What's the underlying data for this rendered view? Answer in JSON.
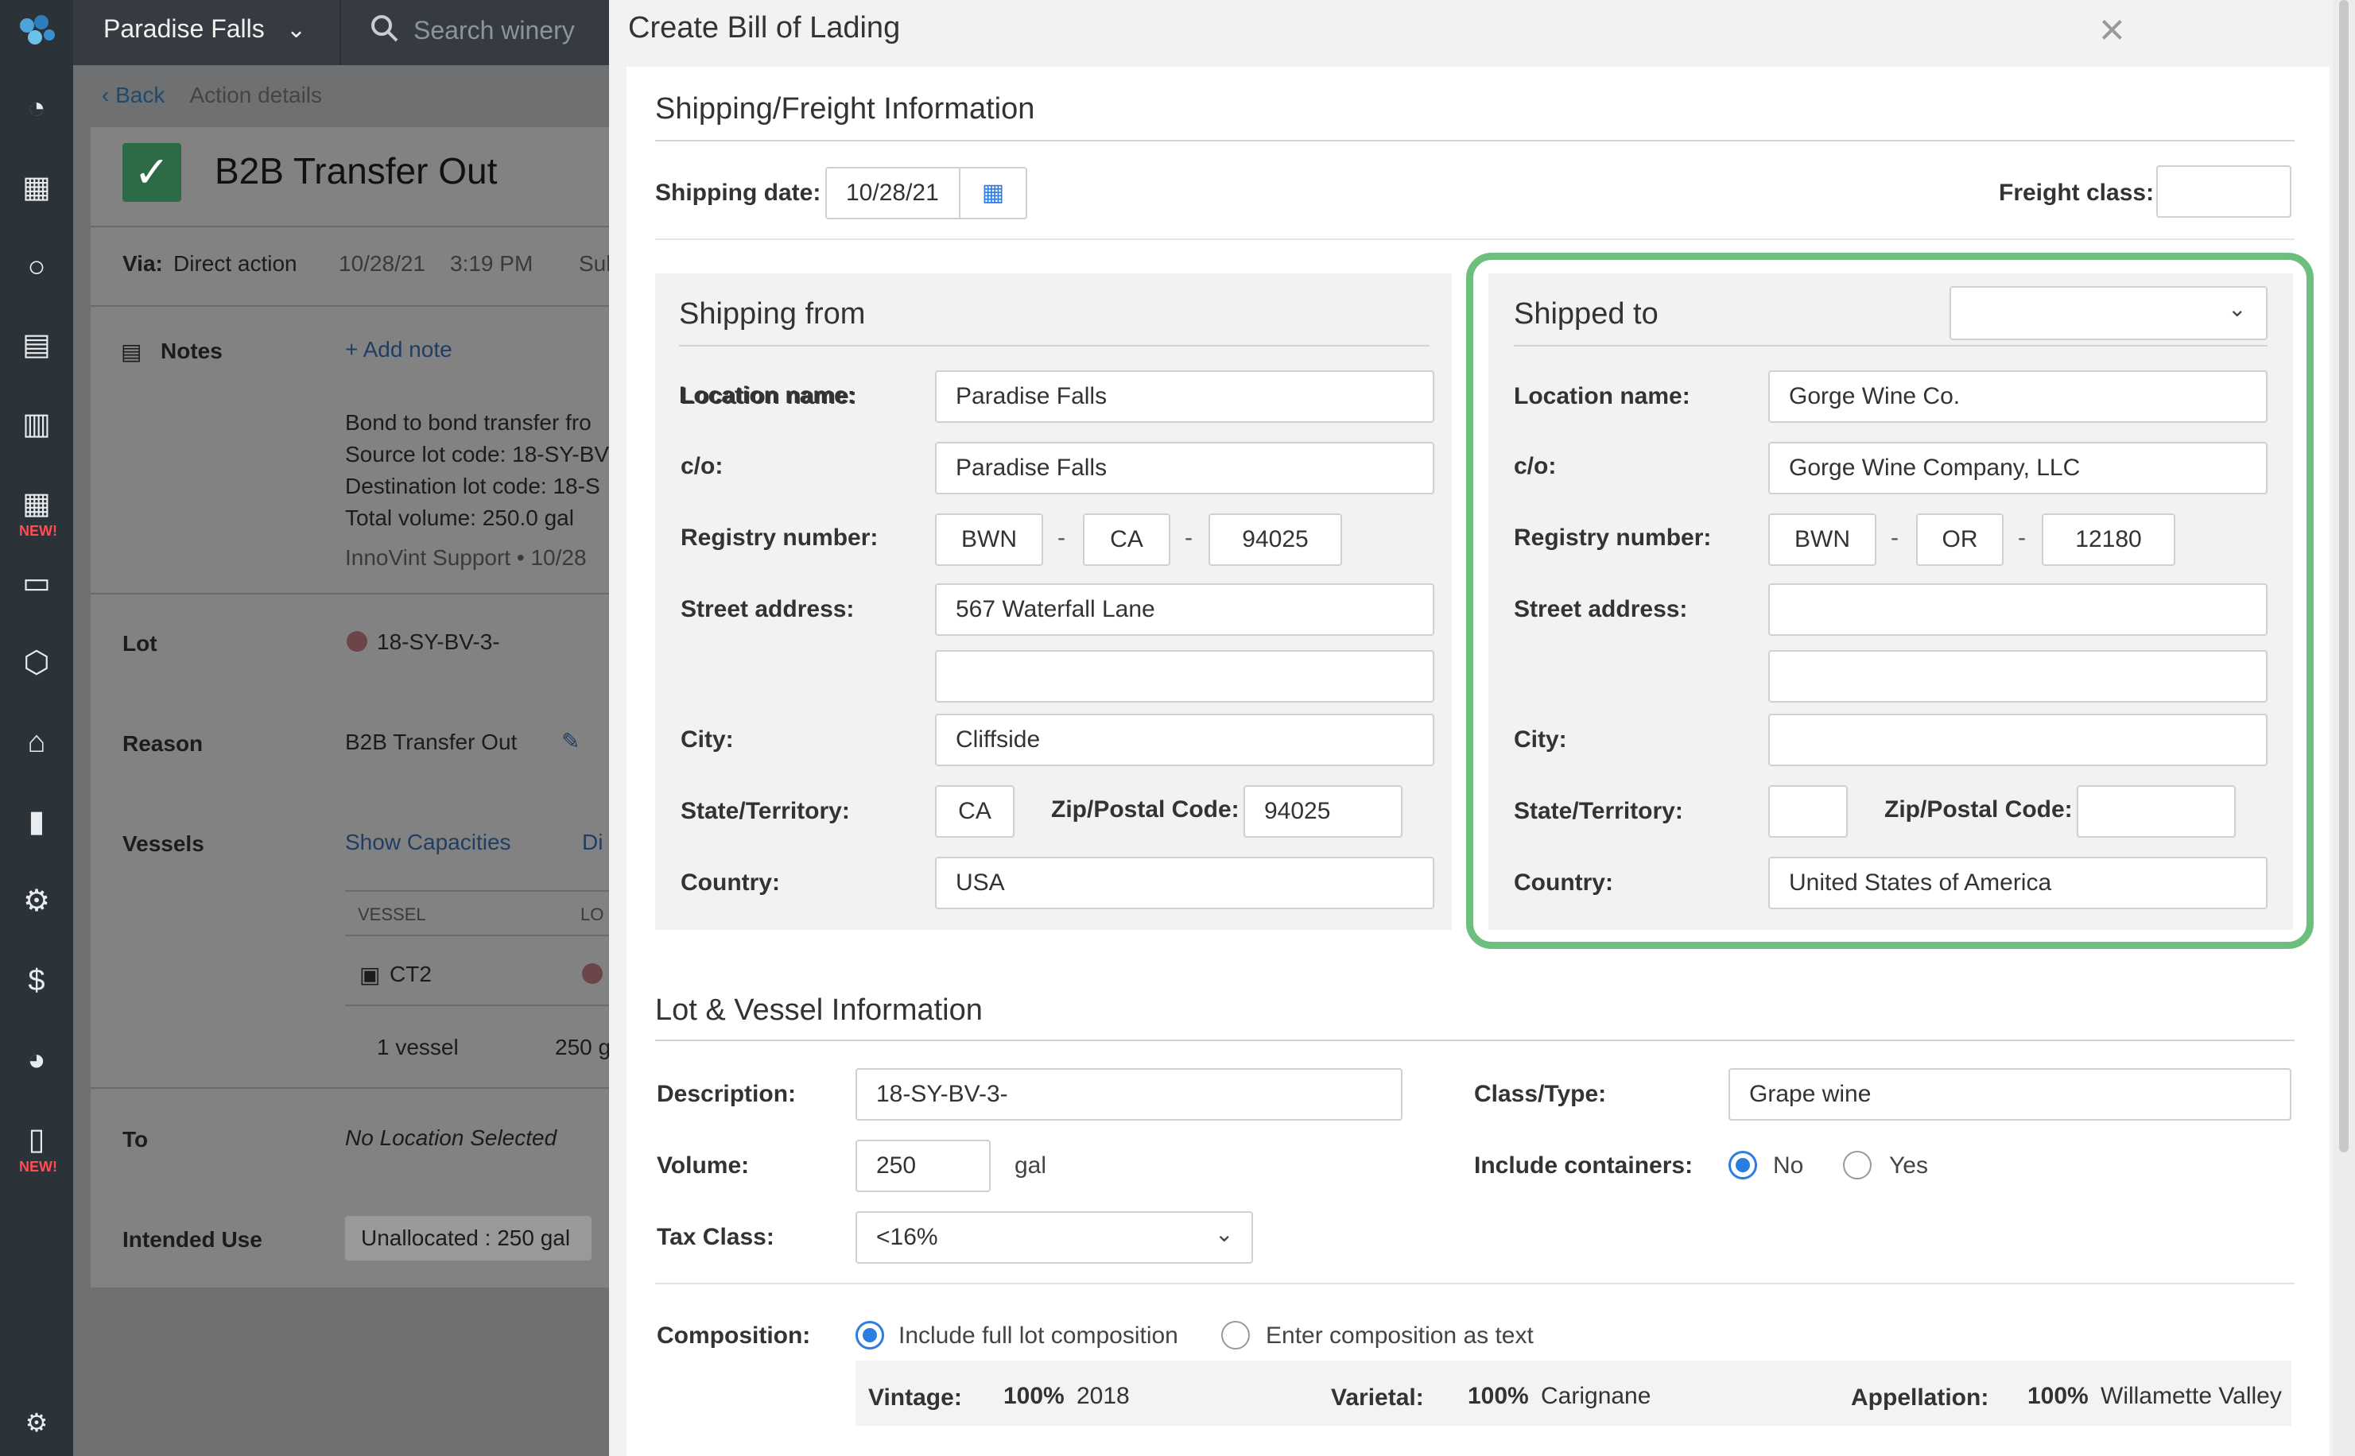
{
  "nav": {
    "winery": "Paradise Falls",
    "search_placeholder": "Search winery",
    "new_badge": "NEW!"
  },
  "background": {
    "back": "Back",
    "breadcrumb": "Action details",
    "title": "B2B Transfer Out",
    "via_label": "Via:",
    "via_value": "Direct action",
    "date": "10/28/21",
    "time": "3:19 PM",
    "truncated_sub": "Sul",
    "notes_label": "Notes",
    "add_note": "+ Add note",
    "note_lines": [
      "Bond to bond transfer fro",
      "Source lot code: 18-SY-BV",
      "Destination lot code: 18-S",
      "Total volume: 250.0 gal"
    ],
    "note_author": "InnoVint Support  •  10/28",
    "lot_label": "Lot",
    "lot_value": "18-SY-BV-3-",
    "reason_label": "Reason",
    "reason_value": "B2B Transfer Out",
    "vessels_label": "Vessels",
    "show_capacities": "Show Capacities",
    "dis_truncated": "Di",
    "vessel_col": "VESSEL",
    "lot_col": "LO",
    "vessel_name": "CT2",
    "vessel_count": "1 vessel",
    "vessel_gal": "250 g",
    "to_label": "To",
    "to_value": "No Location Selected",
    "intended_label": "Intended Use",
    "intended_value": "Unallocated : 250 gal"
  },
  "modal": {
    "title": "Create Bill of Lading",
    "shipping_section": "Shipping/Freight Information",
    "shipping_date_label": "Shipping date:",
    "shipping_date": "10/28/21",
    "freight_label": "Freight class:",
    "freight_value": "",
    "from": {
      "title": "Shipping from",
      "location_label": "Location name:",
      "location": "Paradise Falls",
      "co_label": "c/o:",
      "co": "Paradise Falls",
      "registry_label": "Registry number:",
      "reg1": "BWN",
      "reg2": "CA",
      "reg3": "94025",
      "street_label": "Street address:",
      "street1": "567 Waterfall Lane",
      "street2": "",
      "city_label": "City:",
      "city": "Cliffside",
      "state_label": "State/Territory:",
      "state": "CA",
      "zip_label": "Zip/Postal Code:",
      "zip": "94025",
      "country_label": "Country:",
      "country": "USA"
    },
    "to": {
      "title": "Shipped to",
      "select_value": "",
      "location_label": "Location name:",
      "location": "Gorge Wine Co.",
      "co_label": "c/o:",
      "co": "Gorge Wine Company, LLC",
      "registry_label": "Registry number:",
      "reg1": "BWN",
      "reg2": "OR",
      "reg3": "12180",
      "street_label": "Street address:",
      "street1": "",
      "street2": "",
      "city_label": "City:",
      "city": "",
      "state_label": "State/Territory:",
      "state": "",
      "zip_label": "Zip/Postal Code:",
      "zip": "",
      "country_label": "Country:",
      "country": "United States of America"
    },
    "lot_section": "Lot & Vessel Information",
    "description_label": "Description:",
    "description": "18-SY-BV-3-",
    "class_label": "Class/Type:",
    "class_value": "Grape wine",
    "volume_label": "Volume:",
    "volume": "250",
    "volume_unit": "gal",
    "containers_label": "Include containers:",
    "containers_no": "No",
    "containers_yes": "Yes",
    "tax_label": "Tax Class:",
    "tax_value": "<16%",
    "composition_label": "Composition:",
    "comp_opt1": "Include full lot composition",
    "comp_opt2": "Enter composition as text",
    "vintage_label": "Vintage:",
    "vintage_pct": "100%",
    "vintage_value": "2018",
    "varietal_label": "Varietal:",
    "varietal_pct": "100%",
    "varietal_value": "Carignane",
    "appellation_label": "Appellation:",
    "appellation_pct": "100%",
    "appellation_value": "Willamette Valley"
  }
}
